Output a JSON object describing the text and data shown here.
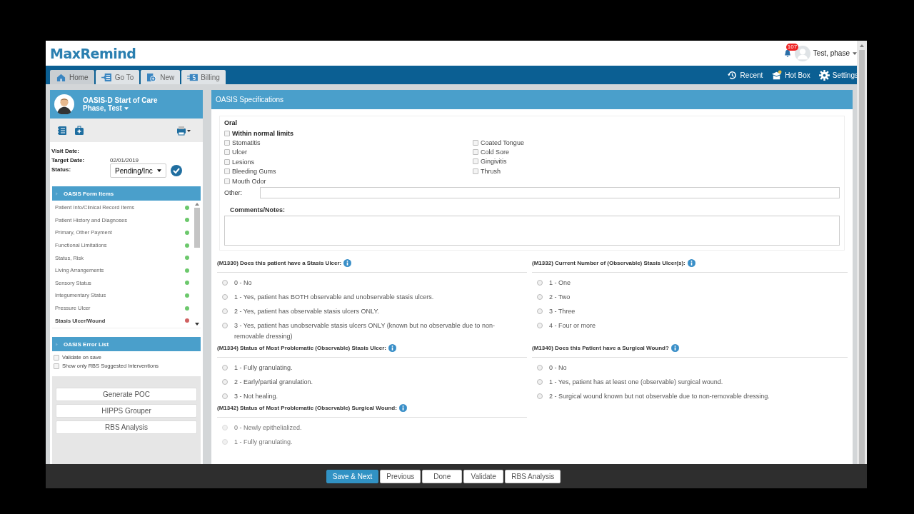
{
  "header": {
    "logo": "MaxRemind",
    "notification_count": "107",
    "user": "Test, phase"
  },
  "nav": {
    "tabs": [
      {
        "label": "Home",
        "selected": true
      },
      {
        "label": "Go To",
        "selected": false
      },
      {
        "label": "New",
        "selected": false
      },
      {
        "label": "Billing",
        "selected": false
      }
    ],
    "links": [
      "Recent",
      "Hot Box",
      "Settings"
    ]
  },
  "patient": {
    "title": "OASIS-D Start of Care",
    "name": "Phase, Test"
  },
  "visit": {
    "visit_date_label": "Visit Date:",
    "target_date_label": "Target Date:",
    "target_date": "02/01/2019",
    "status_label": "Status:",
    "status": "Pending/Inc"
  },
  "form_items": {
    "title": "OASIS Form Items",
    "items": [
      {
        "label": "Patient Info/Clinical Record Items",
        "selected": false,
        "color": "#6cc86c"
      },
      {
        "label": "Patient History and Diagnoses",
        "selected": false,
        "color": "#6cc86c"
      },
      {
        "label": "Primary, Other Payment",
        "selected": false,
        "color": "#6cc86c"
      },
      {
        "label": "Functional Limitations",
        "selected": false,
        "color": "#6cc86c"
      },
      {
        "label": "Status, Risk",
        "selected": false,
        "color": "#6cc86c"
      },
      {
        "label": "Living Arrangements",
        "selected": false,
        "color": "#6cc86c"
      },
      {
        "label": "Sensory Status",
        "selected": false,
        "color": "#6cc86c"
      },
      {
        "label": "Integumentary Status",
        "selected": false,
        "color": "#6cc86c"
      },
      {
        "label": "Pressure Ulcer",
        "selected": false,
        "color": "#6cc86c"
      },
      {
        "label": "Stasis Ulcer/Wound",
        "selected": true,
        "color": "#d06060"
      }
    ]
  },
  "error_list": {
    "title": "OASIS Error List",
    "options": [
      {
        "label": "Validate on save",
        "checked": false
      },
      {
        "label": "Show only RBS Suggested Interventions",
        "checked": false
      }
    ]
  },
  "side_buttons": [
    "Generate POC",
    "HIPPS Grouper",
    "RBS Analysis"
  ],
  "section_title": "OASIS Specifications",
  "oral": {
    "title": "Oral",
    "columns": [
      [
        {
          "label": "Within normal limits",
          "checked": false,
          "bold": true
        },
        {
          "label": "Stomatitis",
          "checked": false,
          "bold": false
        },
        {
          "label": "Ulcer",
          "checked": false,
          "bold": false
        },
        {
          "label": "Lesions",
          "checked": false,
          "bold": false
        },
        {
          "label": "Bleeding Gums",
          "checked": false,
          "bold": false
        },
        {
          "label": "Mouth Odor",
          "checked": false,
          "bold": false
        }
      ],
      [
        {
          "label": "Coated Tongue",
          "checked": false,
          "bold": false
        },
        {
          "label": "Cold Sore",
          "checked": false,
          "bold": false
        },
        {
          "label": "Gingivitis",
          "checked": false,
          "bold": false
        },
        {
          "label": "Thrush",
          "checked": false,
          "bold": false
        }
      ]
    ],
    "other_label": "Other:",
    "comments_label": "Comments/Notes:"
  },
  "questions": [
    {
      "title": "(M1330) Does this patient have a Stasis Ulcer:",
      "disabled": false,
      "options": [
        {
          "label": "0 - No",
          "selected": false
        },
        {
          "label": "1 - Yes, patient has BOTH observable and unobservable stasis ulcers.",
          "selected": false
        },
        {
          "label": "2 - Yes, patient has observable stasis ulcers ONLY.",
          "selected": false
        },
        {
          "label": "3 - Yes, patient has unobservable stasis ulcers ONLY (known but no observable due to non-removable dressing)",
          "selected": false
        }
      ]
    },
    {
      "title": "(M1332) Current Number of (Observable) Stasis Ulcer(s):",
      "disabled": false,
      "options": [
        {
          "label": "1 - One",
          "selected": false
        },
        {
          "label": "2 - Two",
          "selected": false
        },
        {
          "label": "3 - Three",
          "selected": false
        },
        {
          "label": "4 - Four or more",
          "selected": false
        }
      ]
    },
    {
      "title": "(M1334) Status of Most Problematic (Observable) Stasis Ulcer:",
      "disabled": false,
      "options": [
        {
          "label": "1 - Fully granulating.",
          "selected": false
        },
        {
          "label": "2 - Early/partial granulation.",
          "selected": false
        },
        {
          "label": "3 - Not healing.",
          "selected": false
        }
      ]
    },
    {
      "title": "(M1340) Does this Patient have a Surgical Wound?",
      "disabled": false,
      "options": [
        {
          "label": "0 - No",
          "selected": false
        },
        {
          "label": "1 - Yes, patient has at least one (observable) surgical wound.",
          "selected": false
        },
        {
          "label": "2 - Surgical wound known but not observable due to non-removable dressing.",
          "selected": false
        }
      ]
    },
    {
      "title": "(M1342) Status of Most Problematic (Observable) Surgical Wound:",
      "disabled": true,
      "options": [
        {
          "label": "0 - Newly epithelialized.",
          "selected": false
        },
        {
          "label": "1 - Fully granulating.",
          "selected": false
        }
      ]
    }
  ],
  "actions": [
    {
      "label": "Save & Next",
      "primary": true
    },
    {
      "label": "Previous",
      "primary": false
    },
    {
      "label": "Done",
      "primary": false
    },
    {
      "label": "Validate",
      "primary": false
    },
    {
      "label": "RBS Analysis",
      "primary": false
    }
  ]
}
